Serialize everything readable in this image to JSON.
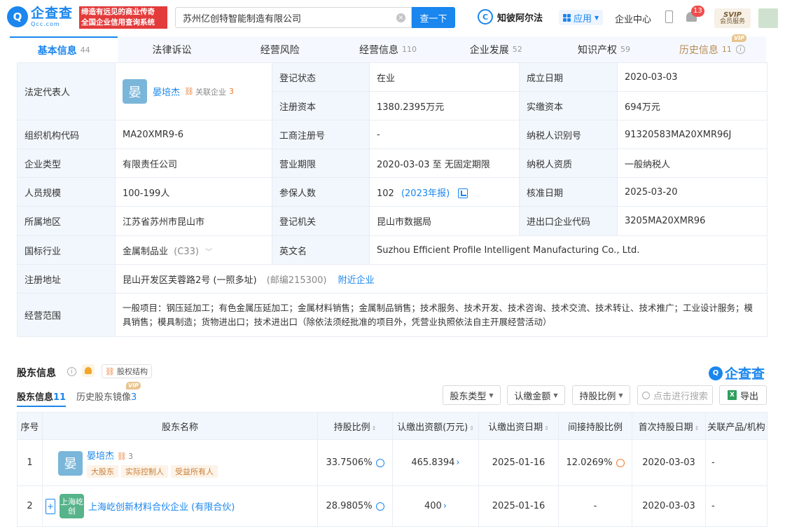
{
  "header": {
    "logo_mark": "Q",
    "logo_cn": "企查查",
    "logo_en": "Qcc.com",
    "slogan_line1": "缔造有远见的商业传奇",
    "slogan_line2": "全国企业信用查询系统",
    "search_value": "苏州亿创特智能制造有限公司",
    "search_button": "查一下",
    "zbar_label": "知彼阿尔法",
    "app_label": "应用",
    "center_label": "企业中心",
    "notification_count": "13",
    "svip_title": "SVIP",
    "svip_sub": "会员服务"
  },
  "tabs": [
    {
      "label": "基本信息",
      "count": "44"
    },
    {
      "label": "法律诉讼",
      "count": ""
    },
    {
      "label": "经营风险",
      "count": ""
    },
    {
      "label": "经营信息",
      "count": "110"
    },
    {
      "label": "企业发展",
      "count": "52"
    },
    {
      "label": "知识产权",
      "count": "59"
    },
    {
      "label": "历史信息",
      "count": "11",
      "badge": "VIP"
    }
  ],
  "info": {
    "legal_rep_label": "法定代表人",
    "legal_rep_avatar": "晏",
    "legal_rep_name": "晏培杰",
    "legal_rep_related": "关联企业",
    "legal_rep_related_count": "3",
    "reg_status_label": "登记状态",
    "reg_status": "在业",
    "found_date_label": "成立日期",
    "found_date": "2020-03-03",
    "reg_capital_label": "注册资本",
    "reg_capital": "1380.2395万元",
    "paid_capital_label": "实缴资本",
    "paid_capital": "694万元",
    "org_code_label": "组织机构代码",
    "org_code": "MA20XMR9-6",
    "biz_reg_no_label": "工商注册号",
    "biz_reg_no": "-",
    "taxpayer_id_label": "纳税人识别号",
    "taxpayer_id": "91320583MA20XMR96J",
    "company_type_label": "企业类型",
    "company_type": "有限责任公司",
    "biz_term_label": "营业期限",
    "biz_term": "2020-03-03 至 无固定期限",
    "taxpayer_qual_label": "纳税人资质",
    "taxpayer_qual": "一般纳税人",
    "staff_size_label": "人员规模",
    "staff_size": "100-199人",
    "insured_label": "参保人数",
    "insured": "102",
    "insured_year": "(2023年报)",
    "approval_date_label": "核准日期",
    "approval_date": "2025-03-20",
    "region_label": "所属地区",
    "region": "江苏省苏州市昆山市",
    "reg_authority_label": "登记机关",
    "reg_authority": "昆山市数据局",
    "import_export_label": "进出口企业代码",
    "import_export": "3205MA20XMR96",
    "industry_label": "国标行业",
    "industry": "金属制品业",
    "industry_code": "(C33)",
    "english_name_label": "英文名",
    "english_name": "Suzhou Efficient Profile Intelligent Manufacturing Co., Ltd.",
    "address_label": "注册地址",
    "address": "昆山开发区芙蓉路2号 (一照多址)",
    "postcode": "(邮编215300)",
    "nearby_link": "附近企业",
    "scope_label": "经营范围",
    "scope": "一般项目：钢压延加工；有色金属压延加工；金属材料销售；金属制品销售；技术服务、技术开发、技术咨询、技术交流、技术转让、技术推广；工业设计服务；模具销售；模具制造；货物进出口；技术进出口（除依法须经批准的项目外，凭营业执照依法自主开展经营活动）"
  },
  "shareholders": {
    "section_title": "股东信息",
    "struct_button": "股权结构",
    "logo_cn": "企查查",
    "subtab_current": "股东信息",
    "subtab_current_count": "11",
    "subtab_history": "历史股东镜像",
    "subtab_history_count": "3",
    "subtab_history_badge": "VIP",
    "filter_type": "股东类型",
    "filter_amount": "认缴金额",
    "filter_ratio": "持股比例",
    "search_placeholder": "点击进行搜索",
    "export_label": "导出",
    "columns": [
      "序号",
      "股东名称",
      "持股比例",
      "认缴出资额(万元)",
      "认缴出资日期",
      "间接持股比例",
      "首次持股日期",
      "关联产品/机构"
    ],
    "rows": [
      {
        "index": "1",
        "avatar": "晏",
        "name": "晏培杰",
        "related_count": "3",
        "tags": [
          "大股东",
          "实际控制人",
          "受益所有人"
        ],
        "ratio": "33.7506%",
        "subscribed": "465.8394",
        "date": "2025-01-16",
        "indirect": "12.0269%",
        "first_date": "2020-03-03",
        "product": "-"
      },
      {
        "index": "2",
        "avatar": "上海屹创",
        "name": "上海屹创新材料合伙企业 (有限合伙)",
        "ratio": "28.9805%",
        "subscribed": "400",
        "date": "2025-01-16",
        "indirect": "-",
        "first_date": "2020-03-03",
        "product": "-"
      }
    ]
  }
}
